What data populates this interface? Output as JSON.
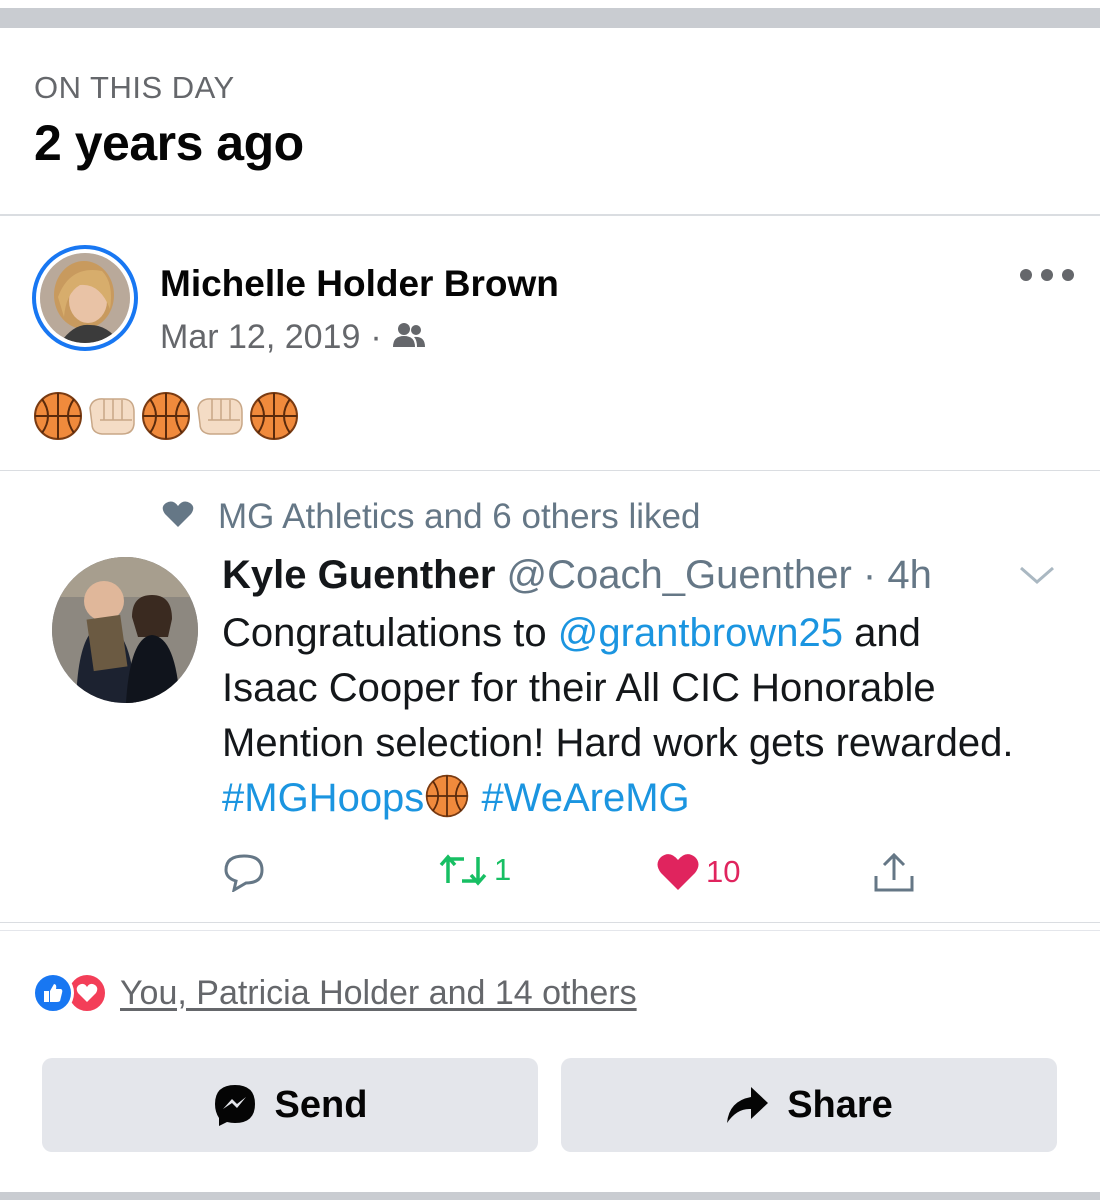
{
  "memory": {
    "kicker": "ON THIS DAY",
    "title": "2 years ago"
  },
  "post": {
    "author": "Michelle Holder Brown",
    "date": "Mar 12, 2019",
    "separator": "·",
    "audience_icon": "friends-icon",
    "emojis": [
      "basketball",
      "fist-bump",
      "basketball",
      "fist-bump",
      "basketball"
    ]
  },
  "tweet": {
    "context": "MG Athletics and 6 others liked",
    "name": "Kyle Guenther",
    "handle": "@Coach_Guenther",
    "time": "· 4h",
    "body": {
      "p1": "Congratulations to ",
      "mention": "@grantbrown25",
      "p2": " and Isaac Cooper for their All CIC Honorable Mention selection! Hard work gets rewarded. ",
      "tag1": "#MGHoops",
      "tag2": "#WeAreMG"
    },
    "retweets": "1",
    "likes": "10"
  },
  "reactions": {
    "text": "You, Patricia Holder and 14 others"
  },
  "actions": {
    "send": "Send",
    "share": "Share"
  },
  "colors": {
    "facebook_blue": "#1877f2",
    "twitter_link": "#1b95e0",
    "retweet_green": "#17bf63",
    "like_red": "#e0245e",
    "button_gray": "#e4e6eb"
  }
}
